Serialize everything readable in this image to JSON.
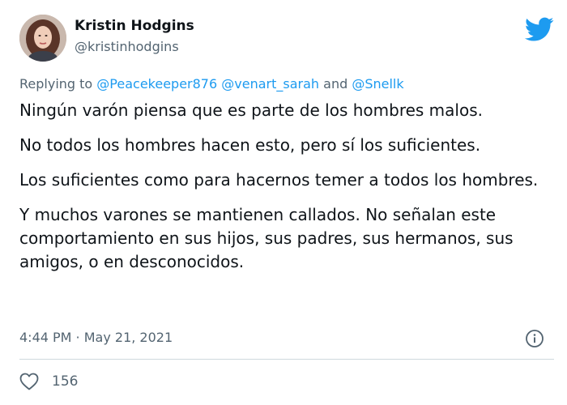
{
  "user": {
    "name": "Kristin Hodgins",
    "handle": "@kristinhodgins",
    "avatar_icon": "profile-photo"
  },
  "brand": {
    "icon": "twitter-bird-icon",
    "color": "#1d9bf0"
  },
  "reply": {
    "prefix": "Replying to ",
    "mention1": "@Peacekeeper876",
    "mention2": "@venart_sarah",
    "joiner": " and ",
    "mention3": "@Snellk"
  },
  "tweet": {
    "paragraphs": [
      "Ningún varón piensa que es parte de los hombres malos.",
      "No todos los hombres hacen esto, pero sí los suficientes.",
      "Los suficientes como para hacernos temer a todos los hombres.",
      "Y muchos varones se mantienen callados. No señalan este comportamiento en sus hijos, sus padres, sus hermanos, sus amigos, o en desconocidos."
    ]
  },
  "meta": {
    "time": "4:44 PM",
    "separator": " · ",
    "date": "May 21, 2021",
    "info_icon": "info-icon"
  },
  "engagement": {
    "like_icon": "heart-icon",
    "likes": "156"
  }
}
